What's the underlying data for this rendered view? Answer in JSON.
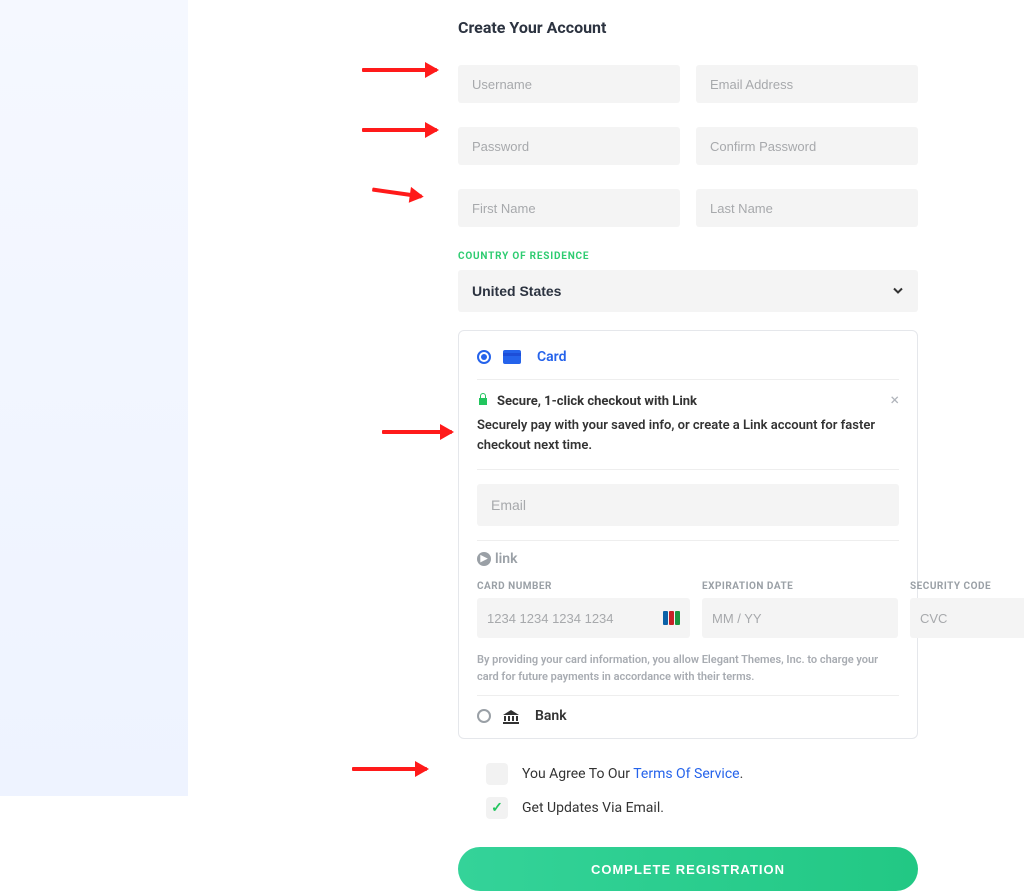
{
  "title": "Create Your Account",
  "fields": {
    "username": "Username",
    "email": "Email Address",
    "password": "Password",
    "confirm_password": "Confirm Password",
    "first_name": "First Name",
    "last_name": "Last Name"
  },
  "country": {
    "label": "COUNTRY OF RESIDENCE",
    "value": "United States"
  },
  "payment": {
    "card_label": "Card",
    "bank_label": "Bank",
    "link_title": "Secure, 1-click checkout with Link",
    "link_desc": "Securely pay with your saved info, or create a Link account for faster checkout next time.",
    "link_email_placeholder": "Email",
    "link_brand": "link",
    "card_number_label": "CARD NUMBER",
    "card_number_placeholder": "1234 1234 1234 1234",
    "expiration_label": "EXPIRATION DATE",
    "expiration_placeholder": "MM / YY",
    "cvc_label": "SECURITY CODE",
    "cvc_placeholder": "CVC",
    "disclaimer": "By providing your card information, you allow Elegant Themes, Inc. to charge your card for future payments in accordance with their terms."
  },
  "agreements": {
    "tos_prefix": "You Agree To Our ",
    "tos_link": "Terms Of Service",
    "tos_suffix": ".",
    "updates": "Get Updates Via Email."
  },
  "submit": "COMPLETE REGISTRATION"
}
